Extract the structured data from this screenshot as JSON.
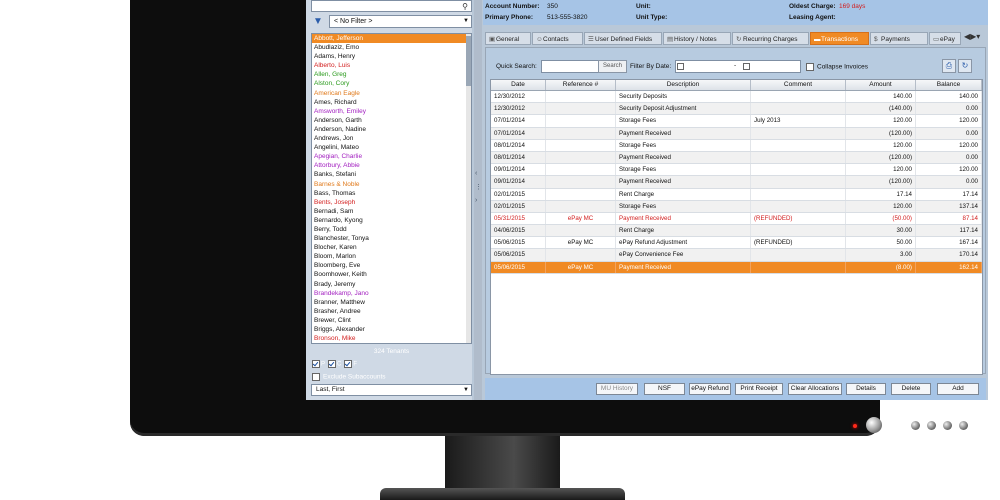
{
  "left_panel": {
    "filter": "< No Filter >",
    "tenants": [
      {
        "name": "Abbott, Jefferson",
        "color": "#ffffff",
        "selected": true
      },
      {
        "name": "Abudlaziz, Emo",
        "color": "#111111"
      },
      {
        "name": "Adams, Henry",
        "color": "#111111"
      },
      {
        "name": "Alberto, Luis",
        "color": "#d21d1d"
      },
      {
        "name": "Allen, Greg",
        "color": "#2a9a1c"
      },
      {
        "name": "Alston, Cory",
        "color": "#2a9a1c"
      },
      {
        "name": "American Eagle",
        "color": "#e0791a"
      },
      {
        "name": "Ames, Richard",
        "color": "#111111"
      },
      {
        "name": "Amsworth, Emiley",
        "color": "#a21ec0"
      },
      {
        "name": "Anderson, Garth",
        "color": "#111111"
      },
      {
        "name": "Anderson, Nadine",
        "color": "#111111"
      },
      {
        "name": "Andrews, Jon",
        "color": "#111111"
      },
      {
        "name": "Angelini, Mateo",
        "color": "#111111"
      },
      {
        "name": "Apegian, Charlie",
        "color": "#a21ec0"
      },
      {
        "name": "Attorbury, Abbie",
        "color": "#a21ec0"
      },
      {
        "name": "Banks, Stefani",
        "color": "#111111"
      },
      {
        "name": "Barnes & Noble",
        "color": "#e0791a"
      },
      {
        "name": "Bass, Thomas",
        "color": "#111111"
      },
      {
        "name": "Bents, Joseph",
        "color": "#d21d1d"
      },
      {
        "name": "Bernadi, Sam",
        "color": "#111111"
      },
      {
        "name": "Bernardo, Kyong",
        "color": "#111111"
      },
      {
        "name": "Berry, Todd",
        "color": "#111111"
      },
      {
        "name": "Blanchester, Tonya",
        "color": "#111111"
      },
      {
        "name": "Blocher, Karen",
        "color": "#111111"
      },
      {
        "name": "Bloom, Marlon",
        "color": "#111111"
      },
      {
        "name": "Bloomberg, Eve",
        "color": "#111111"
      },
      {
        "name": "Boomhower, Keith",
        "color": "#111111"
      },
      {
        "name": "Brady, Jeremy",
        "color": "#111111"
      },
      {
        "name": "Brandekamp, Jano",
        "color": "#a21ec0"
      },
      {
        "name": "Branner, Matthew",
        "color": "#111111"
      },
      {
        "name": "Brasher, Andree",
        "color": "#111111"
      },
      {
        "name": "Brewer, Clint",
        "color": "#111111"
      },
      {
        "name": "Briggs, Alexander",
        "color": "#111111"
      },
      {
        "name": "Bronson, Mike",
        "color": "#d21d1d"
      }
    ],
    "tenant_count": "324 Tenants",
    "checks": [
      "P",
      "C",
      "F"
    ],
    "exclude_label": "Exclude Subaccounts",
    "sort": "Last, First"
  },
  "info": {
    "account_number_label": "Account Number:",
    "account_number": "350",
    "primary_phone_label": "Primary Phone:",
    "primary_phone": "513-555-3820",
    "unit_label": "Unit:",
    "unit_type_label": "Unit Type:",
    "oldest_charge_label": "Oldest Charge:",
    "oldest_charge": "169 days",
    "leasing_agent_label": "Leasing Agent:"
  },
  "tabs": [
    {
      "label": "General",
      "icon": "general-icon"
    },
    {
      "label": "Contacts",
      "icon": "contacts-icon"
    },
    {
      "label": "User Defined Fields",
      "icon": "fields-icon"
    },
    {
      "label": "History / Notes",
      "icon": "notes-icon"
    },
    {
      "label": "Recurring Charges",
      "icon": "recurring-icon"
    },
    {
      "label": "Transactions",
      "icon": "transactions-icon",
      "active": true
    },
    {
      "label": "Payments",
      "icon": "dollar-icon"
    },
    {
      "label": "ePay",
      "icon": "epay-icon"
    }
  ],
  "toolbar": {
    "quick_search_label": "Quick Search:",
    "search_button": "Search",
    "filter_date_label": "Filter By Date:",
    "date_separator": "-",
    "collapse_label": "Collapse Invoices"
  },
  "grid": {
    "columns": [
      "Date",
      "Reference #",
      "Description",
      "Comment",
      "Amount",
      "Balance"
    ],
    "rows": [
      {
        "date": "12/30/2012",
        "ref": "",
        "desc": "Security Deposits",
        "comment": "",
        "amount": "140.00",
        "balance": "140.00"
      },
      {
        "date": "12/30/2012",
        "ref": "",
        "desc": "Security Deposit Adjustment",
        "comment": "",
        "amount": "(140.00)",
        "balance": "0.00"
      },
      {
        "date": "07/01/2014",
        "ref": "",
        "desc": "Storage Fees",
        "comment": "July 2013",
        "amount": "120.00",
        "balance": "120.00"
      },
      {
        "date": "07/01/2014",
        "ref": "",
        "desc": "Payment Received",
        "comment": "",
        "amount": "(120.00)",
        "balance": "0.00"
      },
      {
        "date": "08/01/2014",
        "ref": "",
        "desc": "Storage Fees",
        "comment": "",
        "amount": "120.00",
        "balance": "120.00"
      },
      {
        "date": "08/01/2014",
        "ref": "",
        "desc": "Payment Received",
        "comment": "",
        "amount": "(120.00)",
        "balance": "0.00"
      },
      {
        "date": "09/01/2014",
        "ref": "",
        "desc": "Storage Fees",
        "comment": "",
        "amount": "120.00",
        "balance": "120.00"
      },
      {
        "date": "09/01/2014",
        "ref": "",
        "desc": "Payment Received",
        "comment": "",
        "amount": "(120.00)",
        "balance": "0.00"
      },
      {
        "date": "02/01/2015",
        "ref": "",
        "desc": "Rent Charge",
        "comment": "",
        "amount": "17.14",
        "balance": "17.14"
      },
      {
        "date": "02/01/2015",
        "ref": "",
        "desc": "Storage Fees",
        "comment": "",
        "amount": "120.00",
        "balance": "137.14"
      },
      {
        "date": "05/31/2015",
        "ref": "ePay MC",
        "desc": "Payment Received",
        "comment": "(REFUNDED)",
        "amount": "(50.00)",
        "balance": "87.14",
        "style": "red"
      },
      {
        "date": "04/06/2015",
        "ref": "",
        "desc": "Rent Charge",
        "comment": "",
        "amount": "30.00",
        "balance": "117.14"
      },
      {
        "date": "05/06/2015",
        "ref": "ePay MC",
        "desc": "ePay Refund Adjustment",
        "comment": "(REFUNDED)",
        "amount": "50.00",
        "balance": "167.14"
      },
      {
        "date": "05/06/2015",
        "ref": "",
        "desc": "ePay Convenience Fee",
        "comment": "",
        "amount": "3.00",
        "balance": "170.14"
      },
      {
        "date": "05/06/2015",
        "ref": "ePay MC",
        "desc": "Payment Received",
        "comment": "",
        "amount": "(8.00)",
        "balance": "162.14",
        "style": "highlight"
      }
    ]
  },
  "actions": [
    {
      "label": "MU History",
      "disabled": true
    },
    {
      "label": "NSF"
    },
    {
      "label": "ePay Refund"
    },
    {
      "label": "Print Receipt"
    },
    {
      "label": "Clear Allocations"
    },
    {
      "label": "Details"
    },
    {
      "label": "Delete"
    },
    {
      "label": "Add"
    }
  ]
}
